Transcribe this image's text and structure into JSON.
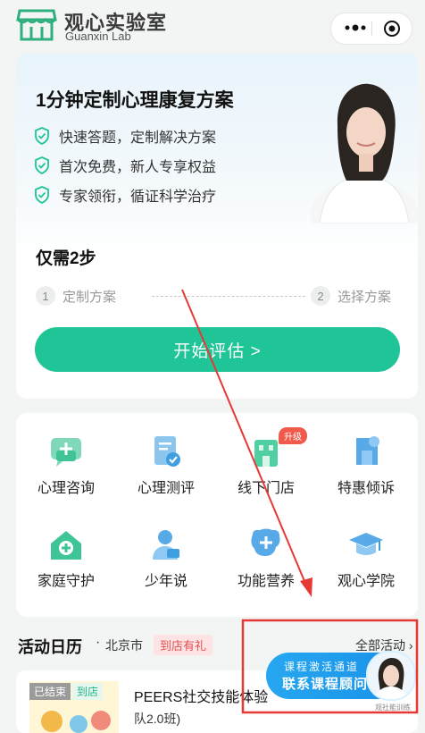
{
  "header": {
    "brand_cn": "观心实验室",
    "brand_en": "Guanxin Lab",
    "more_icon": "more-dots-icon",
    "close_icon": "target-circle-icon"
  },
  "hero": {
    "title": "1分钟定制心理康复方案",
    "features": [
      "快速答题，定制解决方案",
      "首次免费，新人专享权益",
      "专家领衔，循证科学治疗"
    ],
    "steps_title": "仅需2步",
    "step1_num": "1",
    "step1_label": "定制方案",
    "step2_num": "2",
    "step2_label": "选择方案",
    "start_button": "开始评估 >"
  },
  "services": [
    {
      "label": "心理咨询",
      "icon": "chat-plus-icon"
    },
    {
      "label": "心理测评",
      "icon": "clipboard-check-icon"
    },
    {
      "label": "线下门店",
      "icon": "building-icon",
      "badge": "升级"
    },
    {
      "label": "特惠倾诉",
      "icon": "puzzle-icon"
    },
    {
      "label": "家庭守护",
      "icon": "house-cross-icon"
    },
    {
      "label": "少年说",
      "icon": "person-icon"
    },
    {
      "label": "功能营养",
      "icon": "brain-plus-icon"
    },
    {
      "label": "观心学院",
      "icon": "graduation-cap-icon"
    }
  ],
  "activity": {
    "title": "活动日历",
    "dot": "·",
    "city": "北京市",
    "tag": "到店有礼",
    "all_link": "全部活动 ›"
  },
  "event": {
    "status_tag": "已结束",
    "type_tag": "到店",
    "name": "PEERS社交技能体验",
    "subtitle": "队2.0班)"
  },
  "float_button": {
    "line1": "课程激活通道",
    "line2": "联系课程顾问",
    "caption": "观社能训练"
  },
  "colors": {
    "brand_green": "#1fc497",
    "float_blue": "#1890e8",
    "annotation_red": "#e53935"
  }
}
